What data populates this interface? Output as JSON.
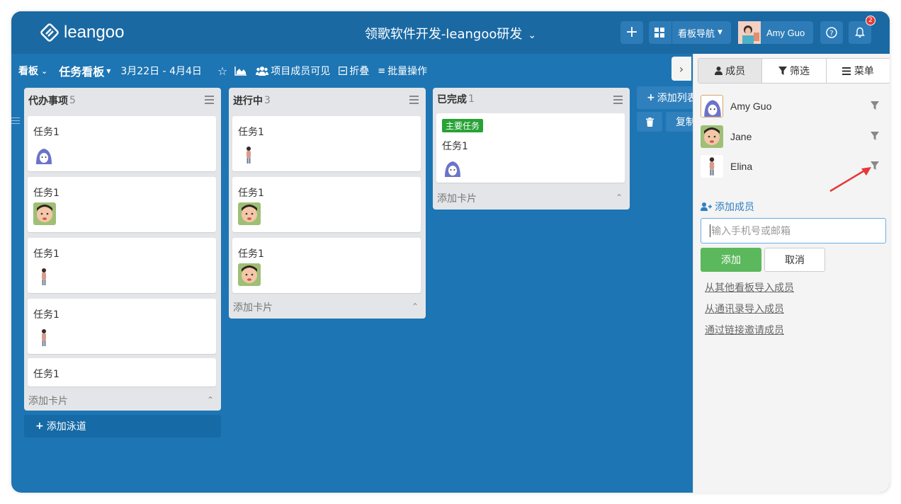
{
  "topbar": {
    "logo_text": "leangoo",
    "board_title": "领歌软件开发-leangoo研发",
    "board_nav_label": "看板导航",
    "user_name": "Amy Guo",
    "notification_count": "2"
  },
  "subbar": {
    "board_label": "看板",
    "board_name": "任务看板",
    "date_range": "3月22日 - 4月4日",
    "visibility": "项目成员可见",
    "fold": "折叠",
    "batch": "批量操作"
  },
  "columns": [
    {
      "title": "代办事项",
      "count": "5",
      "cards": [
        "任务1",
        "任务1",
        "任务1",
        "任务1",
        "任务1"
      ],
      "add_card": "添加卡片"
    },
    {
      "title": "进行中",
      "count": "3",
      "cards": [
        "任务1",
        "任务1",
        "任务1"
      ],
      "add_card": "添加卡片"
    },
    {
      "title": "已完成",
      "count": "1",
      "tag": "主要任务",
      "cards": [
        "任务1"
      ],
      "add_card": "添加卡片"
    }
  ],
  "add_swimlane": "添加泳道",
  "add_column": "添加列表",
  "copy_label": "复制",
  "panel": {
    "tabs": [
      "成员",
      "筛选",
      "菜单"
    ],
    "members": [
      "Amy Guo",
      "Jane",
      "Elina"
    ],
    "add_member": "添加成员",
    "input_placeholder": "输入手机号或邮箱",
    "add_button": "添加",
    "cancel_button": "取消",
    "links": [
      "从其他看板导入成员",
      "从通讯录导入成员",
      "通过链接邀请成员"
    ]
  },
  "colors": {
    "board_bg": "#1d75b3",
    "topbar_bg": "#1a69a3",
    "add_green": "#5cb85c",
    "tag_green": "#27a336",
    "arrow_red": "#e53935"
  }
}
